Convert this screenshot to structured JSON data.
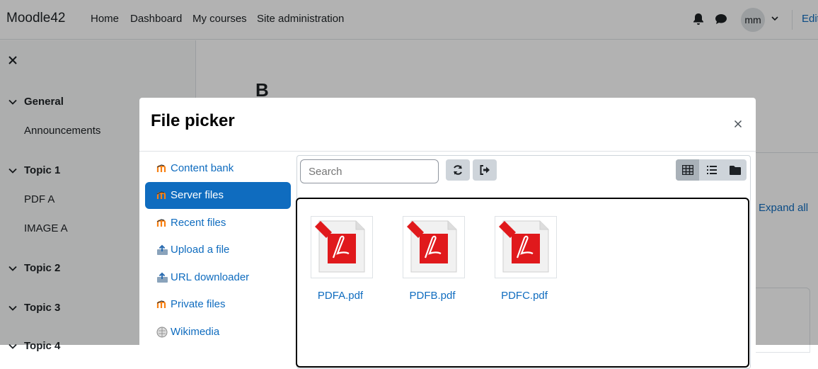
{
  "navbar": {
    "brand": "Moodle42",
    "links": [
      "Home",
      "Dashboard",
      "My courses",
      "Site administration"
    ],
    "avatar_initials": "mm",
    "edit_label": "Edit"
  },
  "drawer": {
    "sections": [
      {
        "title": "General",
        "items": [
          "Announcements"
        ]
      },
      {
        "title": "Topic 1",
        "items": [
          "PDF A",
          "IMAGE A"
        ]
      },
      {
        "title": "Topic 2",
        "items": []
      },
      {
        "title": "Topic 3",
        "items": []
      },
      {
        "title": "Topic 4",
        "items": []
      }
    ]
  },
  "page": {
    "heading": "B",
    "expand_all": "Expand all"
  },
  "modal": {
    "title": "File picker",
    "repositories": [
      {
        "label": "Content bank",
        "icon": "moodle-icon"
      },
      {
        "label": "Server files",
        "icon": "moodle-icon",
        "active": true
      },
      {
        "label": "Recent files",
        "icon": "moodle-icon"
      },
      {
        "label": "Upload a file",
        "icon": "upload-icon"
      },
      {
        "label": "URL downloader",
        "icon": "upload-icon"
      },
      {
        "label": "Private files",
        "icon": "moodle-icon"
      },
      {
        "label": "Wikimedia",
        "icon": "wikimedia-icon"
      }
    ],
    "search_placeholder": "Search",
    "view_modes": [
      "icons-view",
      "list-view",
      "tree-view"
    ],
    "active_view": "icons-view",
    "files": [
      {
        "name": "PDFA.pdf",
        "icon": "pdf-icon"
      },
      {
        "name": "PDFB.pdf",
        "icon": "pdf-icon"
      },
      {
        "name": "PDFC.pdf",
        "icon": "pdf-icon"
      }
    ]
  },
  "colors": {
    "link": "#0f6cbf",
    "active_repo_bg": "#0f6cbf",
    "button_bg": "#ced4da",
    "pdf_red": "#e0191c"
  }
}
